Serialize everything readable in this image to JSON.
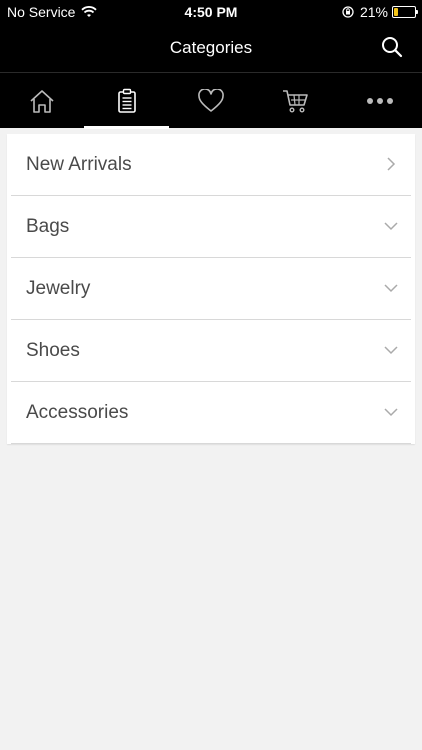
{
  "status": {
    "carrier": "No Service",
    "time": "4:50 PM",
    "battery": "21%",
    "battery_level": 0.21,
    "battery_color": "#f5c518"
  },
  "header": {
    "title": "Categories",
    "search_icon": "search-icon"
  },
  "tabs": [
    {
      "name": "home",
      "icon": "home-icon",
      "active": false
    },
    {
      "name": "categories",
      "icon": "clipboard-icon",
      "active": true
    },
    {
      "name": "favorites",
      "icon": "heart-icon",
      "active": false
    },
    {
      "name": "cart",
      "icon": "cart-icon",
      "active": false
    },
    {
      "name": "more",
      "icon": "more-icon",
      "active": false
    }
  ],
  "categories": [
    {
      "label": "New Arrivals",
      "chevron": "chevron-right-icon"
    },
    {
      "label": "Bags",
      "chevron": "chevron-down-icon"
    },
    {
      "label": "Jewelry",
      "chevron": "chevron-down-icon"
    },
    {
      "label": "Shoes",
      "chevron": "chevron-down-icon"
    },
    {
      "label": "Accessories",
      "chevron": "chevron-down-icon"
    }
  ],
  "colors": {
    "bar_background": "#000000",
    "page_background": "#f2f2f2",
    "text": "#4a4a4a"
  }
}
